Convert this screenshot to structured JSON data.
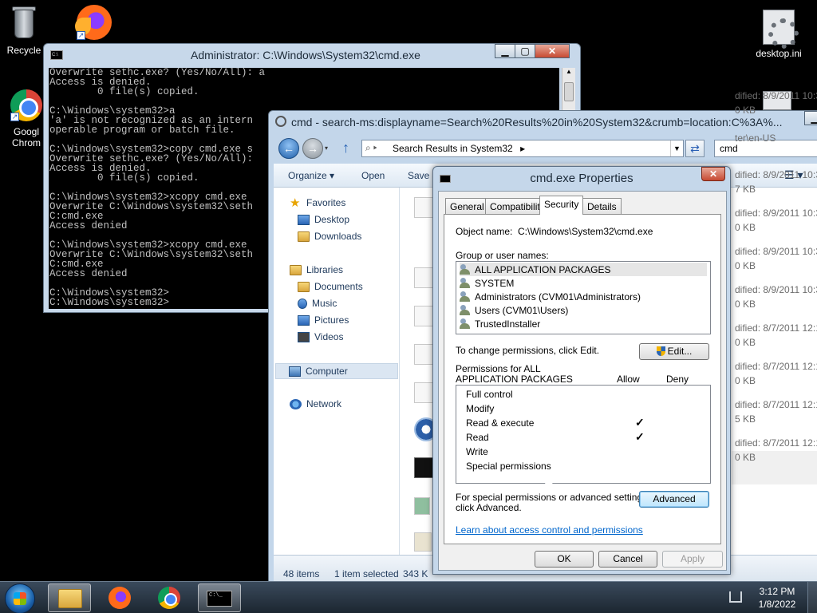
{
  "desktop": {
    "icons": [
      {
        "label": "Recycle",
        "icon": "recycle-bin-icon"
      },
      {
        "label": "",
        "icon": "firefox-icon"
      },
      {
        "label": "Googl Chrom",
        "icon": "chrome-icon"
      },
      {
        "label": "desktop.ini",
        "icon": "settings-file-icon"
      }
    ]
  },
  "cmd": {
    "title": "Administrator: C:\\Windows\\System32\\cmd.exe",
    "lines": [
      "Overwrite sethc.exe? (Yes/No/All): a",
      "Access is denied.",
      "        0 file(s) copied.",
      "",
      "C:\\Windows\\system32>a",
      "'a' is not recognized as an intern",
      "operable program or batch file.",
      "",
      "C:\\Windows\\system32>copy cmd.exe s",
      "Overwrite sethc.exe? (Yes/No/All):",
      "Access is denied.",
      "        0 file(s) copied.",
      "",
      "C:\\Windows\\system32>xcopy cmd.exe",
      "Overwrite C:\\Windows\\system32\\seth",
      "C:cmd.exe",
      "Access denied",
      "",
      "C:\\Windows\\system32>xcopy cmd.exe",
      "Overwrite C:\\Windows\\system32\\seth",
      "C:cmd.exe",
      "Access denied",
      "",
      "C:\\Windows\\system32>",
      "C:\\Windows\\system32>"
    ]
  },
  "explorer": {
    "title": "cmd - search-ms:displayname=Search%20Results%20in%20System32&crumb=location:C%3A%...",
    "address": "Search Results in System32",
    "search_value": "cmd",
    "toolbar": {
      "organize": "Organize ▾",
      "open": "Open",
      "save": "Save s"
    },
    "nav": {
      "favorites": "Favorites",
      "desktop": "Desktop",
      "downloads": "Downloads",
      "libraries": "Libraries",
      "documents": "Documents",
      "music": "Music",
      "pictures": "Pictures",
      "videos": "Videos",
      "computer": "Computer",
      "network": "Network"
    },
    "rows": [
      {
        "top": "dified: 8/9/2011 10:3",
        "bottom": "0 KB"
      },
      {
        "top": "ter\\en-US",
        "bottom": ""
      },
      {
        "top": "dified: 8/9/2011 10:3",
        "bottom": "7 KB"
      },
      {
        "top": "dified: 8/9/2011 10:3",
        "bottom": "0 KB"
      },
      {
        "top": "dified: 8/9/2011 10:3",
        "bottom": "0 KB"
      },
      {
        "top": "dified: 8/9/2011 10:3",
        "bottom": "0 KB"
      },
      {
        "top": "dified: 8/7/2011 12:1",
        "bottom": "0 KB"
      },
      {
        "top": "dified: 8/7/2011 12:1",
        "bottom": "0 KB"
      },
      {
        "top": "dified: 8/7/2011 12:1",
        "bottom": "5 KB"
      },
      {
        "top": "dified: 8/7/2011 12:1",
        "bottom": "0 KB"
      }
    ],
    "status": {
      "count": "48 items",
      "selected": "1 item selected",
      "size": "343 K"
    }
  },
  "props": {
    "title": "cmd.exe Properties",
    "tabs": [
      "General",
      "Compatibility",
      "Security",
      "Details"
    ],
    "object_label": "Object name:",
    "object_value": "C:\\Windows\\System32\\cmd.exe",
    "group_label": "Group or user names:",
    "users": [
      "ALL APPLICATION PACKAGES",
      "SYSTEM",
      "Administrators (CVM01\\Administrators)",
      "Users (CVM01\\Users)",
      "TrustedInstaller"
    ],
    "change_text": "To change permissions, click Edit.",
    "edit_label": "Edit...",
    "perms_for_line1": "Permissions for ALL",
    "perms_for_line2": "APPLICATION PACKAGES",
    "allow_label": "Allow",
    "deny_label": "Deny",
    "permissions": [
      {
        "name": "Full control",
        "allow": "",
        "deny": ""
      },
      {
        "name": "Modify",
        "allow": "",
        "deny": ""
      },
      {
        "name": "Read & execute",
        "allow": "✓",
        "deny": ""
      },
      {
        "name": "Read",
        "allow": "✓",
        "deny": ""
      },
      {
        "name": "Write",
        "allow": "",
        "deny": ""
      },
      {
        "name": "Special permissions",
        "allow": "",
        "deny": ""
      }
    ],
    "special_line1": "For special permissions or advanced settings,",
    "special_line2": "click Advanced.",
    "advanced_label": "Advanced",
    "learn_link": "Learn about access control and permissions",
    "ok_label": "OK",
    "cancel_label": "Cancel",
    "apply_label": "Apply"
  },
  "taskbar": {
    "time": "3:12 PM",
    "date": "1/8/2022",
    "cmd_icon_text": "C:\\_"
  }
}
